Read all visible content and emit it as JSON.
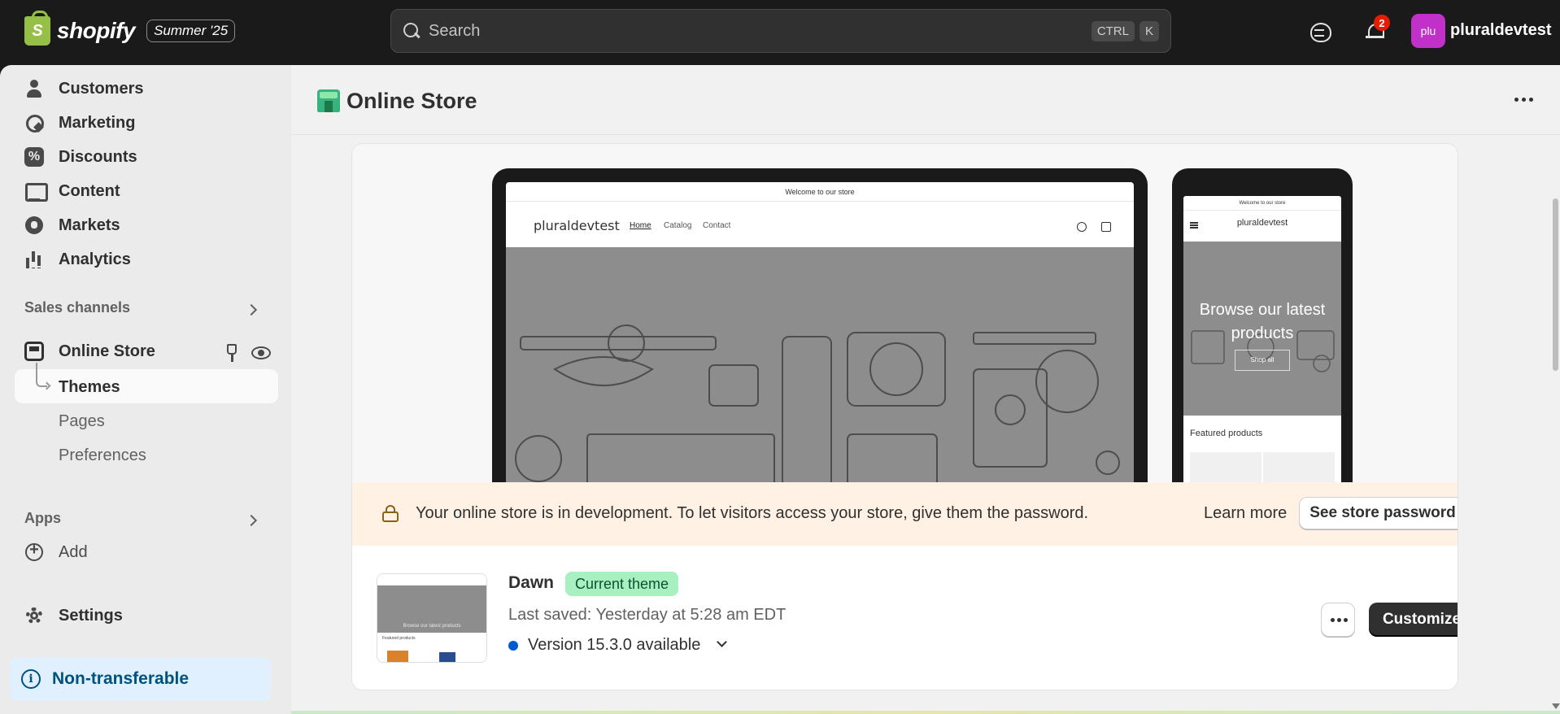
{
  "topbar": {
    "logo_word": "shopify",
    "edition_badge": "Summer '25",
    "search_placeholder": "Search",
    "shortcut_keys": [
      "CTRL",
      "K"
    ],
    "notification_count": "2",
    "avatar_initials": "plu",
    "store_name": "pluraldevtest"
  },
  "sidebar": {
    "nav_items": [
      "Customers",
      "Marketing",
      "Discounts",
      "Content",
      "Markets",
      "Analytics"
    ],
    "sales_channels_label": "Sales channels",
    "online_store_label": "Online Store",
    "sub_items": [
      "Themes",
      "Pages",
      "Preferences"
    ],
    "apps_label": "Apps",
    "add_label": "Add",
    "settings_label": "Settings",
    "non_transferable_label": "Non-transferable"
  },
  "page": {
    "title": "Online Store"
  },
  "preview": {
    "desktop": {
      "announcement": "Welcome to our store",
      "brand": "pluraldevtest",
      "nav": [
        "Home",
        "Catalog",
        "Contact"
      ]
    },
    "mobile": {
      "announcement": "Welcome to our store",
      "brand": "pluraldevtest",
      "hero_title": "Browse our latest products",
      "shop_all": "Shop all",
      "featured": "Featured products"
    }
  },
  "dev_banner": {
    "message": "Your online store is in development. To let visitors access your store, give them the password.",
    "learn_more": "Learn more",
    "button": "See store password"
  },
  "theme": {
    "name": "Dawn",
    "badge": "Current theme",
    "last_saved": "Last saved: Yesterday at 5:28 am EDT",
    "version": "Version 15.3.0 available",
    "customize_label": "Customize",
    "thumb_hero_text": "Browse our latest products",
    "thumb_featured": "Featured products"
  },
  "colors": {
    "topbar": "#1a1a1a",
    "sidebar": "#ebebeb",
    "main_bg": "#f1f1f1",
    "dev_banner_bg": "#fff1e3",
    "badge_green": "#a8f0bf",
    "info_blue": "#00527c",
    "avatar": "#c130c9"
  }
}
